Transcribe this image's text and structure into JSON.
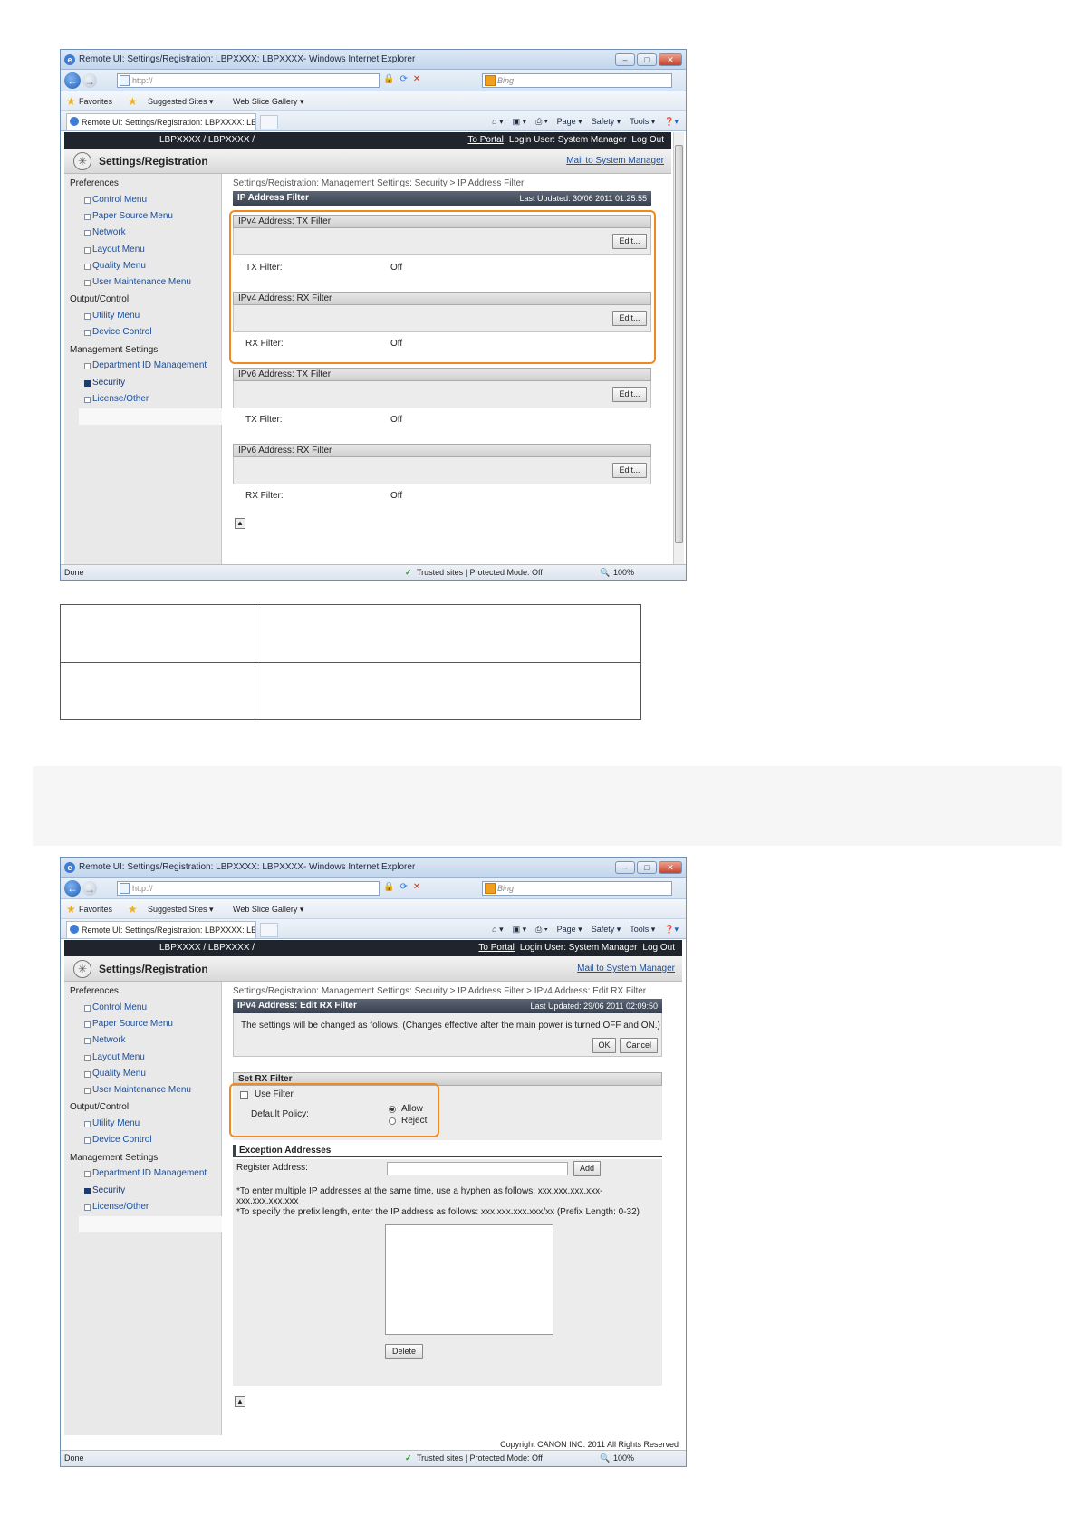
{
  "browser": {
    "window_title": "Remote UI: Settings/Registration: LBPXXXX: LBPXXXX- Windows Internet Explorer",
    "address": "http://",
    "search_placeholder": "Bing",
    "favorites_label": "Favorites",
    "suggested_sites": "Suggested Sites ▾",
    "web_slice_gallery": "Web Slice Gallery ▾",
    "tab_title": "Remote UI: Settings/Registration: LBPXXXX: LBPX...",
    "cmd_page": "Page ▾",
    "cmd_safety": "Safety ▾",
    "cmd_tools": "Tools ▾",
    "status_done": "Done",
    "status_zone": "Trusted sites | Protected Mode: Off",
    "status_zoom": "100%"
  },
  "app": {
    "product": "LBPXXXX / LBPXXXX /",
    "to_portal": "To Portal",
    "login_user": "Login User: System Manager",
    "log_out": "Log Out",
    "title": "Settings/Registration",
    "mail": "Mail to System Manager",
    "copyright": "Copyright CANON INC. 2011 All Rights Reserved"
  },
  "sidebar": {
    "preferences": "Preferences",
    "control_menu": "Control Menu",
    "paper_source_menu": "Paper Source Menu",
    "network": "Network",
    "layout_menu": "Layout Menu",
    "quality_menu": "Quality Menu",
    "user_maintenance_menu": "User Maintenance Menu",
    "output_control": "Output/Control",
    "utility_menu": "Utility Menu",
    "device_control": "Device Control",
    "management_settings": "Management Settings",
    "department_id": "Department ID Management",
    "security": "Security",
    "license_other": "License/Other"
  },
  "screen1": {
    "breadcrumb": "Settings/Registration: Management Settings: Security > IP Address Filter",
    "header": "IP Address Filter",
    "last_updated": "Last Updated: 30/06 2011 01:25:55",
    "edit_label": "Edit...",
    "panels": [
      {
        "title": "IPv4 Address: TX Filter",
        "key": "TX Filter:",
        "value": "Off"
      },
      {
        "title": "IPv4 Address: RX Filter",
        "key": "RX Filter:",
        "value": "Off"
      },
      {
        "title": "IPv6 Address: TX Filter",
        "key": "TX Filter:",
        "value": "Off"
      },
      {
        "title": "IPv6 Address: RX Filter",
        "key": "RX Filter:",
        "value": "Off"
      }
    ]
  },
  "screen2": {
    "breadcrumb": "Settings/Registration: Management Settings: Security > IP Address Filter > IPv4 Address: Edit RX Filter",
    "header": "IPv4 Address: Edit RX Filter",
    "last_updated": "Last Updated: 29/06 2011 02:09:50",
    "notice": "The settings will be changed as follows. (Changes effective after the main power is turned OFF and ON.)",
    "ok": "OK",
    "cancel": "Cancel",
    "set_rx_filter": "Set RX Filter",
    "use_filter": "Use Filter",
    "default_policy": "Default Policy:",
    "allow": "Allow",
    "reject": "Reject",
    "exception_addresses": "Exception Addresses",
    "register_address": "Register Address:",
    "add": "Add",
    "note1": "*To enter multiple IP addresses at the same time, use a hyphen as follows: xxx.xxx.xxx.xxx-",
    "note1b": "xxx.xxx.xxx.xxx",
    "note2": "*To specify the prefix length, enter the IP address as follows: xxx.xxx.xxx.xxx/xx (Prefix Length: 0-32)",
    "delete": "Delete"
  }
}
